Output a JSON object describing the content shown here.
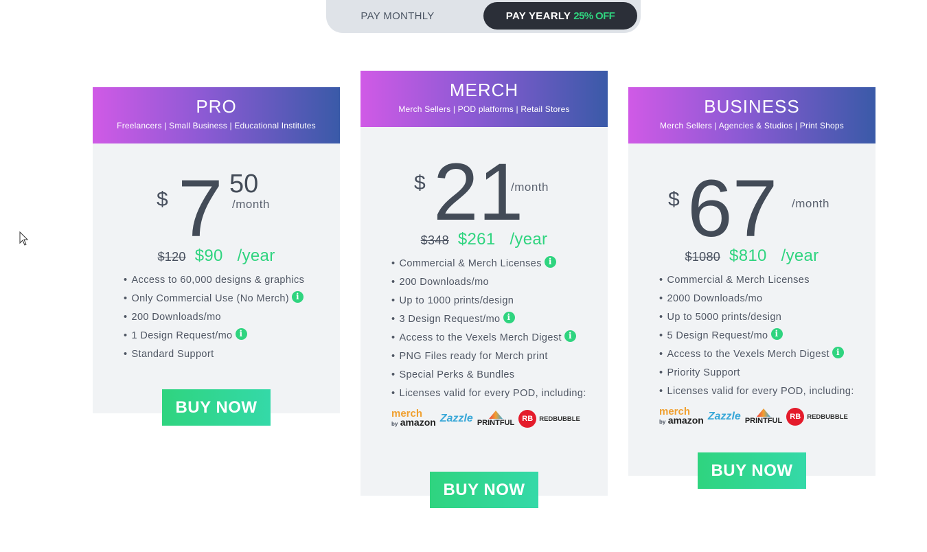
{
  "toggle": {
    "monthly_label": "PAY MONTHLY",
    "yearly_label": "PAY YEARLY",
    "yearly_discount": "25% OFF",
    "selected": "yearly"
  },
  "colors": {
    "accent": "#2fd47f",
    "toggle_active": "#2b2f38",
    "gradient_start": "#d05ae6",
    "gradient_end": "#3a5aa8"
  },
  "plans": [
    {
      "name": "PRO",
      "subtitle": "Freelancers | Small Business | Educational Institutes",
      "currency": "$",
      "price_main": "7",
      "price_cents": "50",
      "per_month": "/month",
      "old_year_price": "$120",
      "year_price": "$90",
      "year_unit": "/year",
      "features": [
        {
          "text": "Access to 60,000 designs & graphics",
          "info": false
        },
        {
          "text": "Only Commercial Use (No Merch)",
          "info": true
        },
        {
          "text": "200 Downloads/mo",
          "info": false
        },
        {
          "text": "1 Design Request/mo",
          "info": true
        },
        {
          "text": "Standard Support",
          "info": false
        }
      ],
      "buy_label": "BUY NOW"
    },
    {
      "name": "MERCH",
      "subtitle": "Merch Sellers | POD platforms | Retail Stores",
      "currency": "$",
      "price_main": "21",
      "per_month": "/month",
      "old_year_price": "$348",
      "year_price": "$261",
      "year_unit": "/year",
      "features": [
        {
          "text": "Commercial & Merch Licenses",
          "info": true
        },
        {
          "text": "200 Downloads/mo",
          "info": false
        },
        {
          "text": "Up to 1000 prints/design",
          "info": false
        },
        {
          "text": "3 Design Request/mo",
          "info": true
        },
        {
          "text": "Access to the Vexels Merch Digest",
          "info": true
        },
        {
          "text": "PNG Files ready for Merch print",
          "info": false
        },
        {
          "text": "Special Perks & Bundles",
          "info": false
        },
        {
          "text": "Licenses valid for every POD, including:",
          "info": false
        }
      ],
      "buy_label": "BUY NOW"
    },
    {
      "name": "BUSINESS",
      "subtitle": "Merch Sellers | Agencies & Studios | Print Shops",
      "currency": "$",
      "price_main": "67",
      "per_month": "/month",
      "old_year_price": "$1080",
      "year_price": "$810",
      "year_unit": "/year",
      "features": [
        {
          "text": "Commercial & Merch Licenses",
          "info": false
        },
        {
          "text": "2000 Downloads/mo",
          "info": false
        },
        {
          "text": "Up to 5000 prints/design",
          "info": false
        },
        {
          "text": "5 Design Request/mo",
          "info": true
        },
        {
          "text": "Access to the Vexels Merch Digest",
          "info": true
        },
        {
          "text": "Priority Support",
          "info": false
        },
        {
          "text": "Licenses valid for every POD, including:",
          "info": false
        }
      ],
      "buy_label": "BUY NOW"
    }
  ],
  "pod_logos": {
    "merch_top": "merch",
    "merch_by": "by",
    "merch_amazon": "amazon",
    "zazzle": "Zazzle",
    "printful": "PRINTFUL",
    "redbubble_mark": "RB",
    "redbubble": "REDBUBBLE"
  },
  "info_glyph": "i",
  "bullet": "•"
}
